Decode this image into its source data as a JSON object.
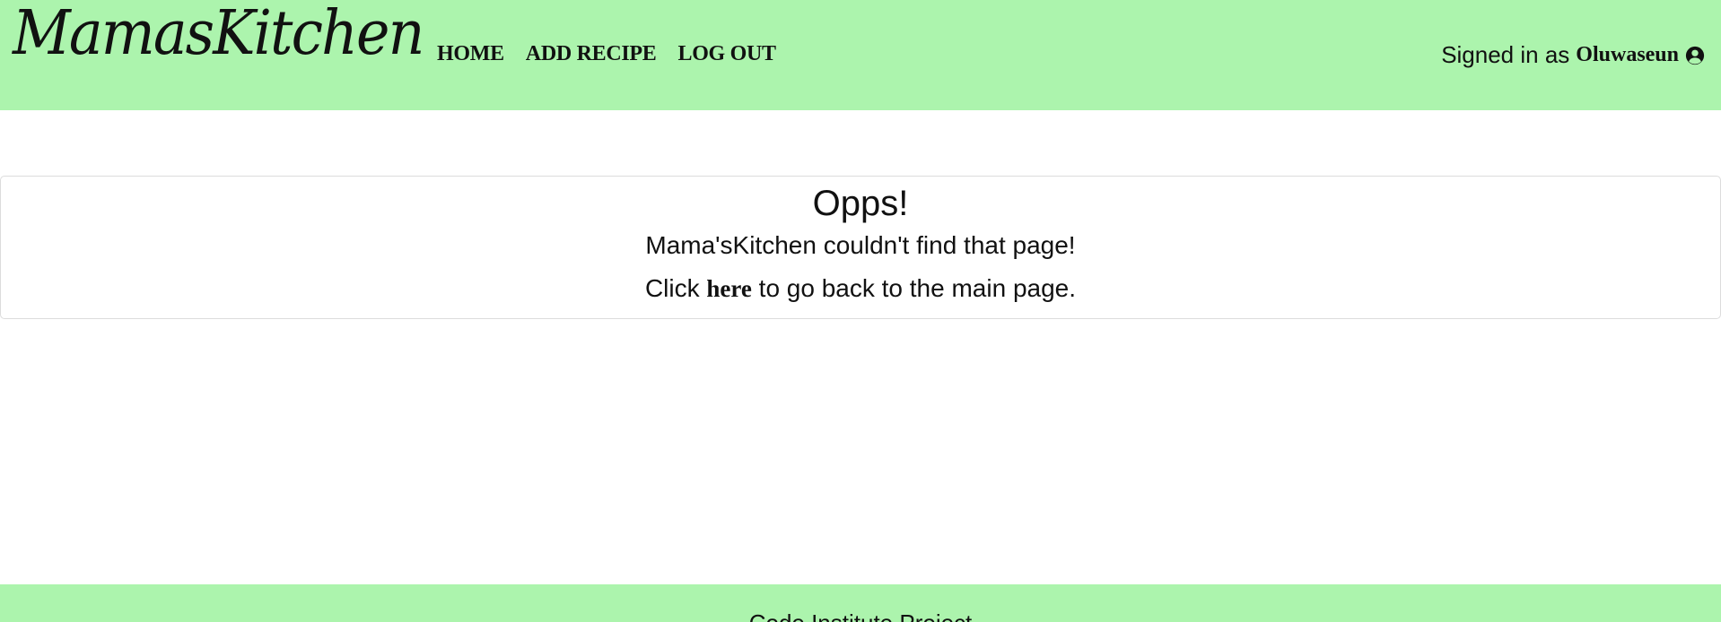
{
  "colors": {
    "navbar_bg": "#acf4ad",
    "footer_bg": "#acf4ad",
    "text": "#111111"
  },
  "navbar": {
    "brand": "MamasKitchen",
    "links": [
      {
        "label": "HOME"
      },
      {
        "label": "ADD RECIPE"
      },
      {
        "label": "LOG OUT"
      }
    ],
    "signed_in_prefix": "Signed in as",
    "username": "Oluwaseun",
    "user_icon": "user-circle-icon"
  },
  "error_card": {
    "title": "Opps!",
    "message": "Mama'sKitchen couldn't find that page!",
    "click_prefix": "Click",
    "link_text": "here",
    "click_suffix": "to go back to the main page."
  },
  "footer": {
    "text": "Code Institute Project"
  }
}
